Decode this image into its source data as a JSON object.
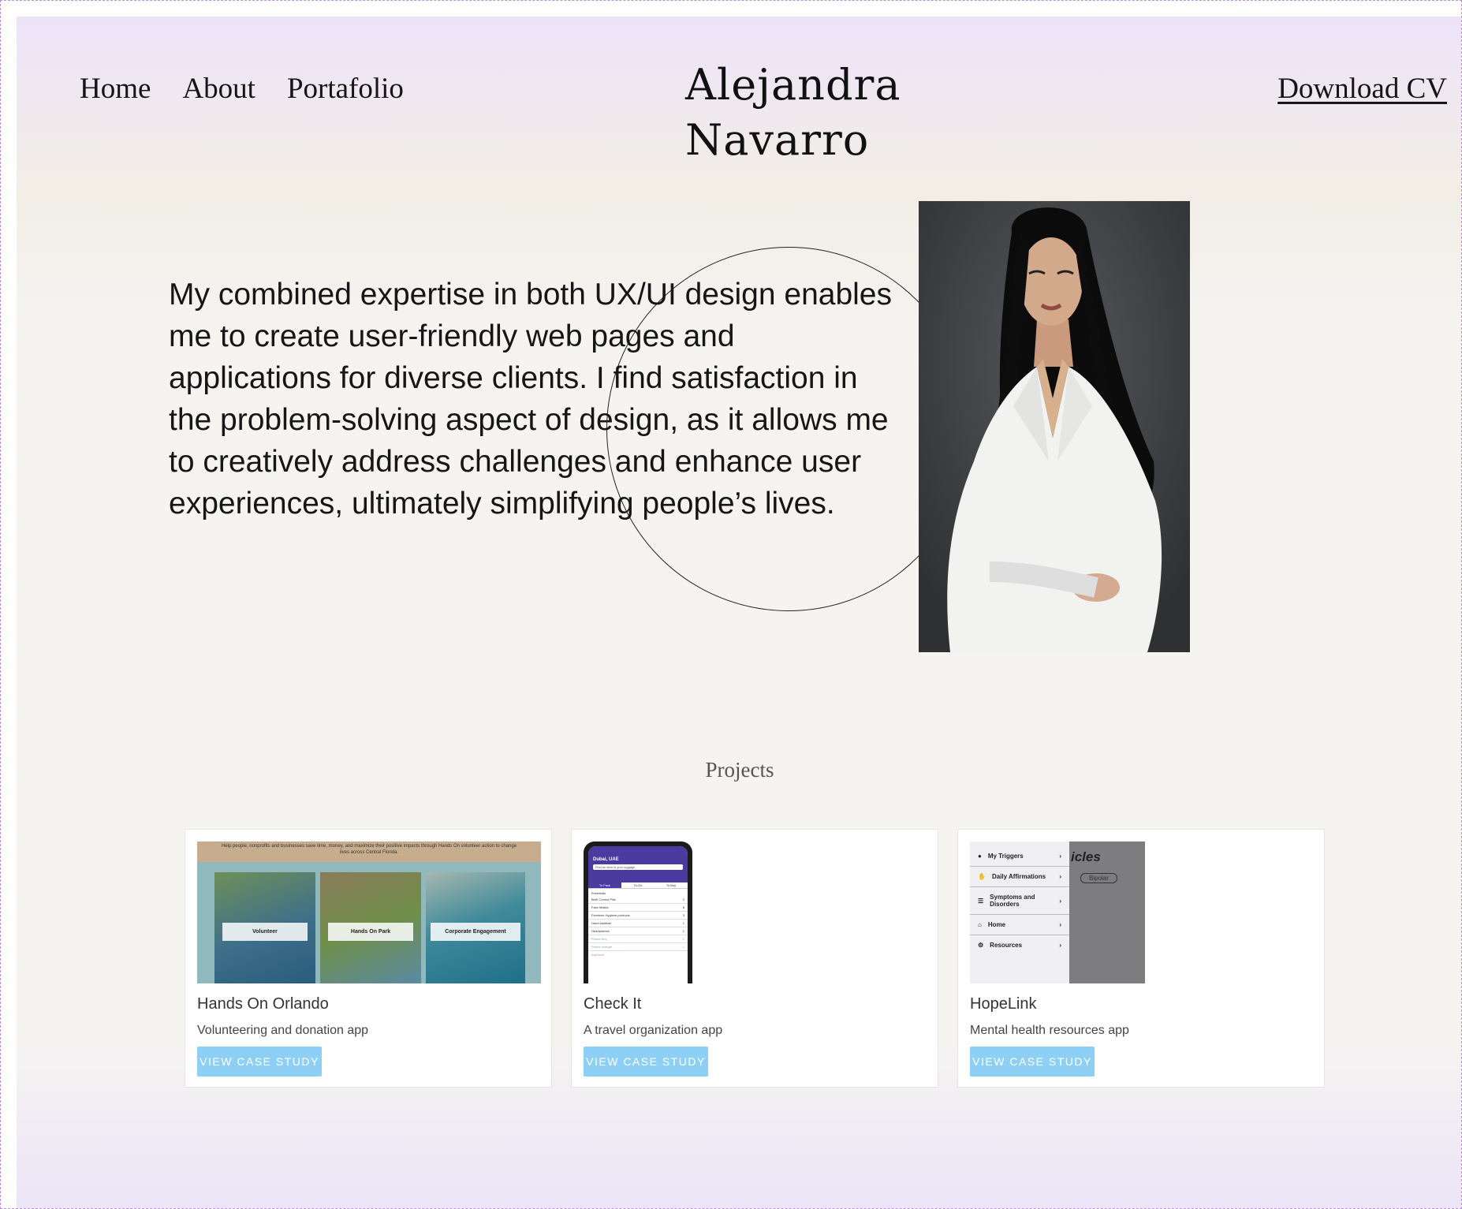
{
  "nav": {
    "items": [
      {
        "label": "Home"
      },
      {
        "label": "About"
      },
      {
        "label": "Portafolio"
      }
    ],
    "brand_line1": "Alejandra",
    "brand_line2": "Navarro",
    "cv_label": "Download CV"
  },
  "hero": {
    "text": "My combined expertise in both UX/UI design enables me to create user-friendly web pages and applications for diverse clients. I find satisfaction in the problem-solving aspect of design, as it allows me to creatively address challenges and enhance user experiences, ultimately simplifying people’s lives."
  },
  "projects": {
    "title": "Projects",
    "cards": [
      {
        "title": "Hands On Orlando",
        "subtitle": "Volunteering and donation app",
        "button": "VIEW CASE STUDY",
        "thumb_banner": "Help people, nonprofits and businesses save time, money, and maximize their positive impacts through Hands On volunteer action to change lives across Central Florida.",
        "thumb_tiles": [
          "Volunteer",
          "Hands On Park",
          "Corporate Engagement"
        ]
      },
      {
        "title": "Check It",
        "subtitle": "A travel organization app",
        "button": "VIEW CASE STUDY",
        "thumb_location": "Dubai, UAE",
        "thumb_search": "Find an item in your luggage",
        "thumb_tabs": [
          "To Pack",
          "To-Do",
          "To Buy"
        ],
        "thumb_section": "Essentials",
        "thumb_items": [
          {
            "label": "Birth Control Pills",
            "qty": "2"
          },
          {
            "label": "Face Masks",
            "qty": "8"
          },
          {
            "label": "Feminine Hygiene products",
            "qty": "3"
          },
          {
            "label": "Hand sanitizer",
            "qty": "1"
          },
          {
            "label": "Headphones",
            "qty": "1"
          },
          {
            "label": "Phone Key",
            "qty": "1"
          },
          {
            "label": "Phone charger",
            "qty": "1"
          }
        ],
        "thumb_add": "Add Item"
      },
      {
        "title": "HopeLink",
        "subtitle": "Mental health resources app",
        "button": "VIEW CASE STUDY",
        "thumb_menu": [
          "My Triggers",
          "Daily Affirmations",
          "Symptoms and Disorders",
          "Home",
          "Resources"
        ],
        "thumb_overlay_title": "icles",
        "thumb_overlay_chip": "Bipolar"
      }
    ]
  },
  "colors": {
    "accent_button": "#8ed0f5",
    "page_top": "#ede3f9",
    "page_mid": "#f5f4f1",
    "checkit_purple": "#4b3aa0"
  }
}
